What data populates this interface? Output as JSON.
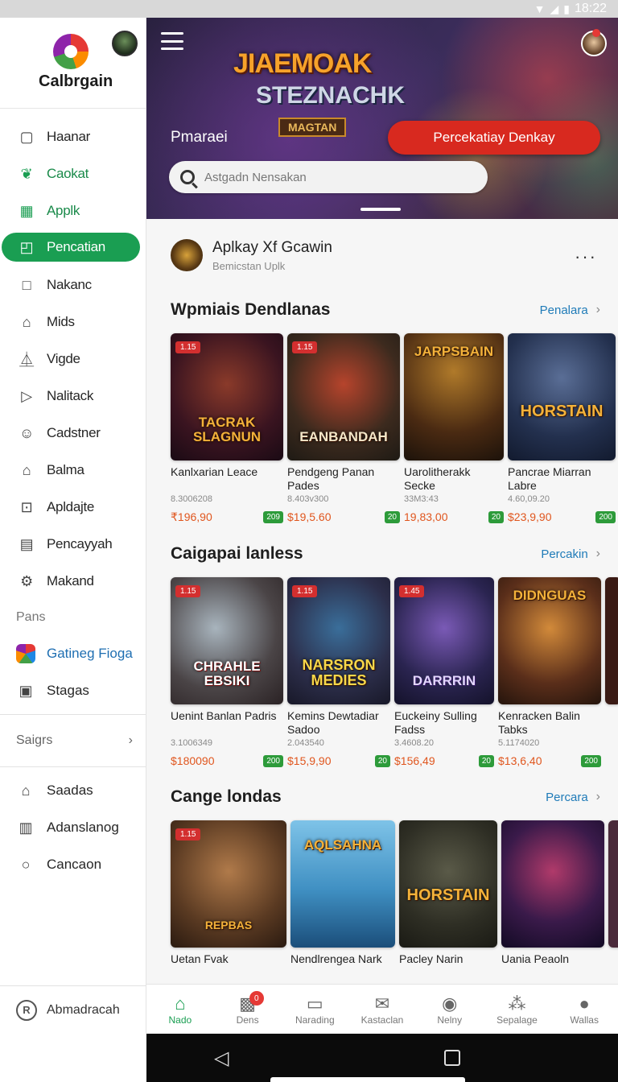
{
  "status": {
    "time": "18:22"
  },
  "drawer": {
    "logo_text": "Calbrgain",
    "nav": [
      {
        "label": "Haanar",
        "icon": "square-icon"
      },
      {
        "label": "Caokat",
        "icon": "leaf-icon"
      },
      {
        "label": "Applk",
        "icon": "grid-icon"
      },
      {
        "label": "Pencatian",
        "icon": "card-icon"
      },
      {
        "label": "Nakanc",
        "icon": "box-icon"
      },
      {
        "label": "Mids",
        "icon": "home-icon"
      },
      {
        "label": "Vigde",
        "icon": "flask-icon"
      },
      {
        "label": "Nalitack",
        "icon": "play-icon"
      },
      {
        "label": "Cadstner",
        "icon": "user-icon"
      },
      {
        "label": "Balma",
        "icon": "house-icon"
      },
      {
        "label": "Apldajte",
        "icon": "frame-icon"
      },
      {
        "label": "Pencayyah",
        "icon": "note-icon"
      },
      {
        "label": "Makand",
        "icon": "gears-icon"
      }
    ],
    "section_label": "Pans",
    "pans": [
      {
        "label": "Gatineg Fioga"
      },
      {
        "label": "Stagas"
      }
    ],
    "settings_label": "Saigrs",
    "extra": [
      {
        "label": "Saadas"
      },
      {
        "label": "Adanslanog"
      },
      {
        "label": "Cancaon"
      }
    ],
    "account_label": "Abmadracah"
  },
  "hero": {
    "art_line1": "JIAEMOAK",
    "art_line2": "STEZNACHK",
    "art_line3": "MAGTAN",
    "label": "Pmaraei",
    "cta": "Percekatiay Denkay",
    "search_placeholder": "Astgadn Nensakan"
  },
  "profile": {
    "title": "Aplkay Xf Gcawin",
    "subtitle": "Bemicstan Uplk",
    "more": "···"
  },
  "sections": [
    {
      "title": "Wpmiais Dendlanas",
      "link": "Penalara",
      "cards": [
        {
          "badge": "1.15",
          "art": "TACRAK SLAGNUN",
          "name": "Kanlxarian Leace",
          "meta": "8.3006208",
          "price": "₹196,90",
          "rating": "209"
        },
        {
          "badge": "1.15",
          "art": "EANBANDAH",
          "name": "Pendgeng Panan Pades",
          "meta": "8.403v300",
          "price": "$19,5.60",
          "rating": "20"
        },
        {
          "badge": "",
          "art": "JARPSBAIN",
          "name": "Uarolitherakk Secke",
          "meta": "33M3:43",
          "price": "19,83,00",
          "rating": "20"
        },
        {
          "badge": "",
          "art": "HORSTAIN",
          "name": "Pancrae Miarran Labre",
          "meta": "4.60,09.20",
          "price": "$23,9,90",
          "rating": "200"
        }
      ]
    },
    {
      "title": "Caigapai lanless",
      "link": "Percakin",
      "cards": [
        {
          "badge": "1.15",
          "art": "CHRAHLE EBSIKI",
          "name": "Uenint Banlan Padris",
          "meta": "3.1006349",
          "price": "$180090",
          "rating": "200"
        },
        {
          "badge": "1.15",
          "art": "NARSRON MEDIES",
          "name": "Kemins Dewtadiar Sadoo",
          "meta": "2.043540",
          "price": "$15,9,90",
          "rating": "20"
        },
        {
          "badge": "1.45",
          "art": "DARRRIN",
          "name": "Euckeiny Sulling Fadss",
          "meta": "3.4608.20",
          "price": "$156,49",
          "rating": "20"
        },
        {
          "badge": "",
          "art": "DIDNGUAS",
          "name": "Kenracken Balin Tabks",
          "meta": "5.1174020",
          "price": "$13,6,40",
          "rating": "200"
        }
      ]
    },
    {
      "title": "Cange londas",
      "link": "Percara",
      "cards": [
        {
          "badge": "1.15",
          "art": "REPBAS",
          "name": "Uetan Fvak"
        },
        {
          "badge": "",
          "art": "AQLSAHNA",
          "name": "Nendlrengea Nark"
        },
        {
          "badge": "",
          "art": "HORSTAIN",
          "name": "Pacley Narin"
        },
        {
          "badge": "",
          "art": "",
          "name": "Uania Peaoln"
        }
      ]
    }
  ],
  "tabs": [
    {
      "label": "Nado",
      "icon": "home-icon"
    },
    {
      "label": "Dens",
      "icon": "gift-icon",
      "badge": "0"
    },
    {
      "label": "Narading",
      "icon": "chat-icon"
    },
    {
      "label": "Kastaclan",
      "icon": "mail-icon"
    },
    {
      "label": "Nelny",
      "icon": "target-icon"
    },
    {
      "label": "Sepalage",
      "icon": "cluster-icon"
    },
    {
      "label": "Wallas",
      "icon": "person-icon"
    }
  ]
}
